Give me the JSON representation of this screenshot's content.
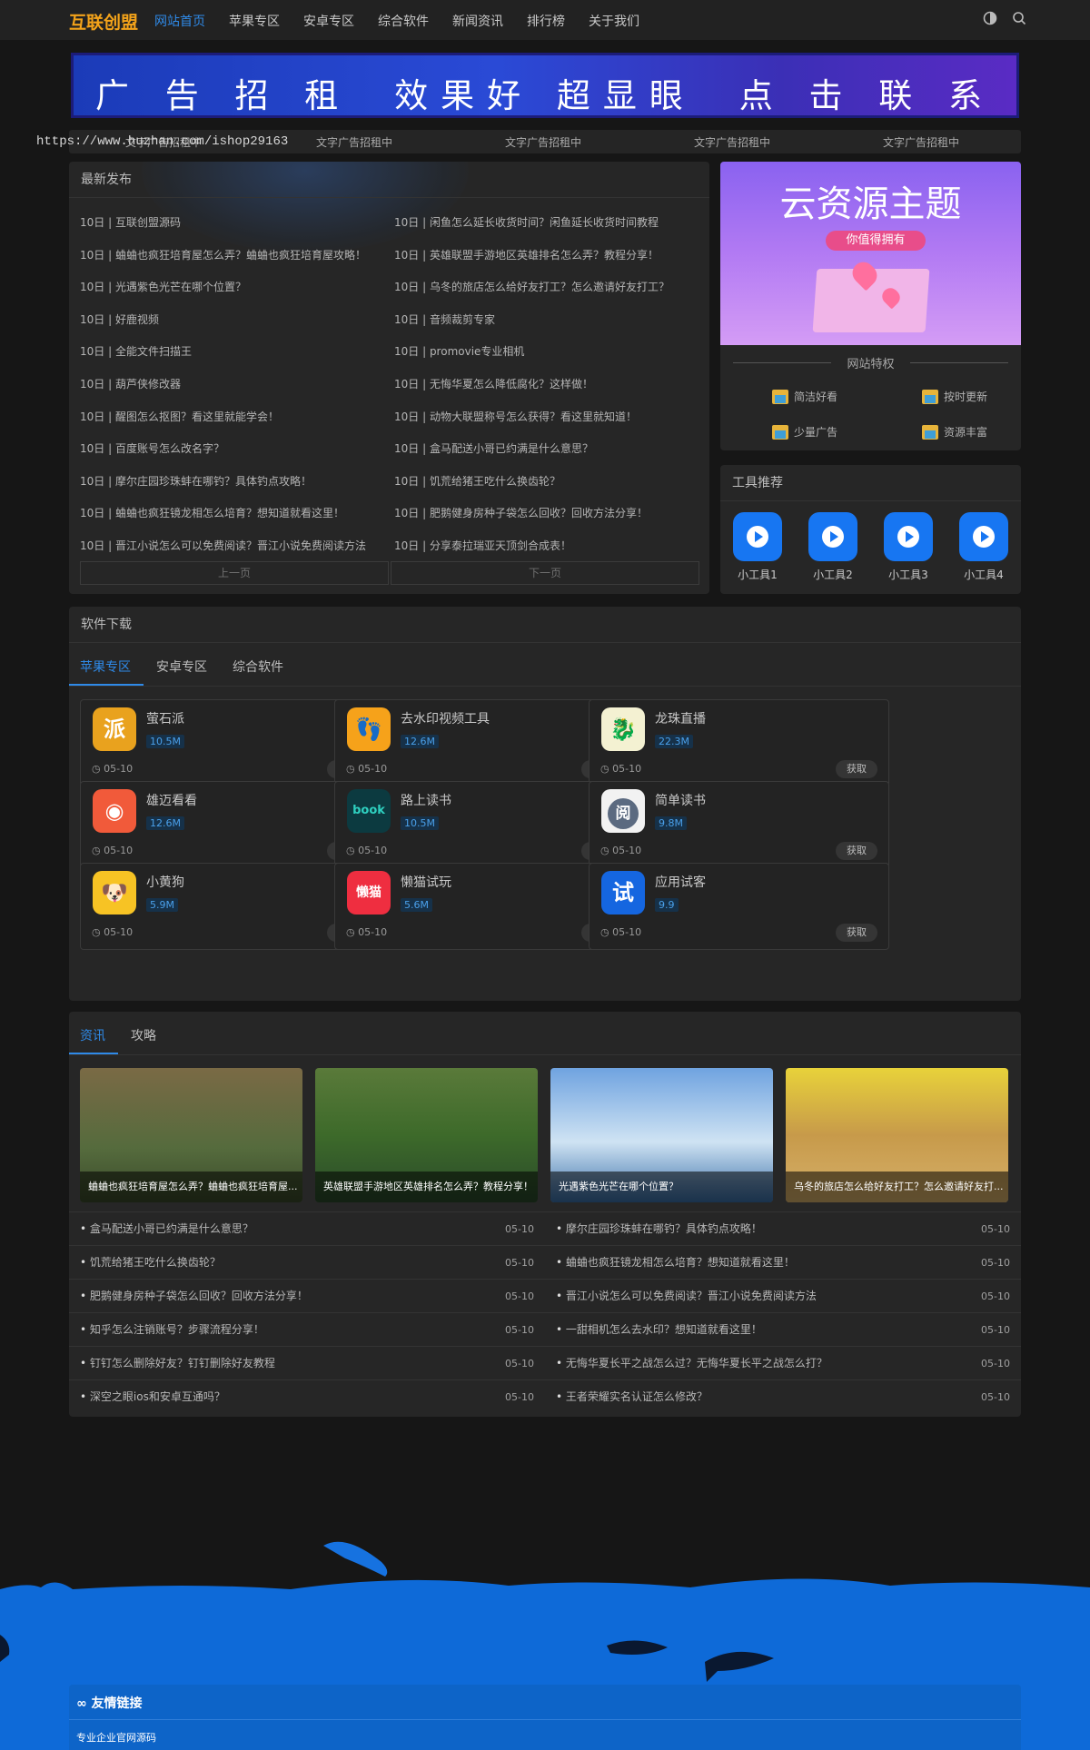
{
  "header": {
    "logo": "互联创盟",
    "nav": [
      "网站首页",
      "苹果专区",
      "安卓专区",
      "综合软件",
      "新闻资讯",
      "排行榜",
      "关于我们"
    ],
    "icons": [
      "theme-toggle-icon",
      "search-icon"
    ]
  },
  "banner": {
    "words": [
      "广 告 招 租",
      "效果好 超显眼",
      "点 击 联 系"
    ]
  },
  "text_ads": {
    "url": "https://www.huzhan.com/ishop29163",
    "items": [
      "文字广告招租中",
      "文字广告招租中",
      "文字广告招租中",
      "文字广告招租中",
      "文字广告招租中"
    ]
  },
  "latest": {
    "title": "最新发布",
    "left": [
      "10日 | 互联创盟源码",
      "10日 | 蛐蛐也疯狂培育屋怎么弄？蛐蛐也疯狂培育屋攻略！",
      "10日 | 光遇紫色光芒在哪个位置？",
      "10日 | 好鹿视频",
      "10日 | 全能文件扫描王",
      "10日 | 葫芦侠修改器",
      "10日 | 醒图怎么抠图？看这里就能学会！",
      "10日 | 百度账号怎么改名字？",
      "10日 | 摩尔庄园珍珠蚌在哪钓？具体钓点攻略！",
      "10日 | 蛐蛐也疯狂镜龙相怎么培育？想知道就看这里！",
      "10日 | 晋江小说怎么可以免费阅读？晋江小说免费阅读方法"
    ],
    "right": [
      "10日 | 闲鱼怎么延长收货时间？闲鱼延长收货时间教程",
      "10日 | 英雄联盟手游地区英雄排名怎么弄？教程分享！",
      "10日 | 乌冬的旅店怎么给好友打工？怎么邀请好友打工？",
      "10日 | 音频裁剪专家",
      "10日 | promovie专业相机",
      "10日 | 无悔华夏怎么降低腐化？这样做！",
      "10日 | 动物大联盟称号怎么获得？看这里就知道！",
      "10日 | 盒马配送小哥已约满是什么意思？",
      "10日 | 饥荒给猪王吃什么换齿轮？",
      "10日 | 肥鹅健身房种子袋怎么回收？回收方法分享！",
      "10日 | 分享泰拉瑞亚天顶剑合成表！"
    ],
    "prev": "上一页",
    "next": "下一页"
  },
  "promo": {
    "title": "云资源主题",
    "subtitle": "你值得拥有",
    "features_title": "网站特权",
    "features": [
      "简洁好看",
      "按时更新",
      "少量广告",
      "资源丰富"
    ]
  },
  "tools": {
    "title": "工具推荐",
    "items": [
      "小工具1",
      "小工具2",
      "小工具3",
      "小工具4"
    ]
  },
  "software": {
    "title": "软件下载",
    "tabs": [
      "苹果专区",
      "安卓专区",
      "综合软件"
    ],
    "get_label": "获取",
    "apps": [
      {
        "name": "萤石派",
        "size": "10.5M",
        "date": "05-10",
        "glyph": "派",
        "color": "#e9a21e"
      },
      {
        "name": "去水印视频工具",
        "size": "12.6M",
        "date": "05-10",
        "glyph": "👣",
        "color": "#f6a21a"
      },
      {
        "name": "龙珠直播",
        "size": "22.3M",
        "date": "05-10",
        "glyph": "🐉",
        "color": "#f4f1d2"
      },
      {
        "name": "雄迈看看",
        "size": "12.6M",
        "date": "05-10",
        "glyph": "◉",
        "color": "#f15a3a"
      },
      {
        "name": "路上读书",
        "size": "10.5M",
        "date": "05-10",
        "glyph": "book",
        "color": "#0c3a40"
      },
      {
        "name": "简单读书",
        "size": "9.8M",
        "date": "05-10",
        "glyph": "阅",
        "color": "#f2f2f2"
      },
      {
        "name": "小黄狗",
        "size": "5.9M",
        "date": "05-10",
        "glyph": "🐶",
        "color": "#f7c324"
      },
      {
        "name": "懒猫试玩",
        "size": "5.6M",
        "date": "05-10",
        "glyph": "懒猫",
        "color": "#ef2e40"
      },
      {
        "name": "应用试客",
        "size": "9.9",
        "date": "05-10",
        "glyph": "试",
        "color": "#1566e0"
      }
    ]
  },
  "news": {
    "tabs": [
      "资讯",
      "攻略"
    ],
    "thumbs": [
      "蛐蛐也疯狂培育屋怎么弄？蛐蛐也疯狂培育屋...",
      "英雄联盟手游地区英雄排名怎么弄？教程分享！",
      "光遇紫色光芒在哪个位置？",
      "乌冬的旅店怎么给好友打工？怎么邀请好友打..."
    ],
    "left": [
      {
        "title": "盒马配送小哥已约满是什么意思？",
        "date": "05-10"
      },
      {
        "title": "饥荒给猪王吃什么换齿轮？",
        "date": "05-10"
      },
      {
        "title": "肥鹅健身房种子袋怎么回收？回收方法分享！",
        "date": "05-10"
      },
      {
        "title": "知乎怎么注销账号？步骤流程分享！",
        "date": "05-10"
      },
      {
        "title": "钉钉怎么删除好友？钉钉删除好友教程",
        "date": "05-10"
      },
      {
        "title": "深空之眼ios和安卓互通吗？",
        "date": "05-10"
      }
    ],
    "right": [
      {
        "title": "摩尔庄园珍珠蚌在哪钓？具体钓点攻略！",
        "date": "05-10"
      },
      {
        "title": "蛐蛐也疯狂镜龙相怎么培育？想知道就看这里！",
        "date": "05-10"
      },
      {
        "title": "晋江小说怎么可以免费阅读？晋江小说免费阅读方法",
        "date": "05-10"
      },
      {
        "title": "一甜相机怎么去水印？想知道就看这里！",
        "date": "05-10"
      },
      {
        "title": "无悔华夏长平之战怎么过？无悔华夏长平之战怎么打？",
        "date": "05-10"
      },
      {
        "title": "王者荣耀实名认证怎么修改？",
        "date": "05-10"
      }
    ]
  },
  "links": {
    "title": "友情链接",
    "items": [
      "专业企业官网源码"
    ]
  }
}
